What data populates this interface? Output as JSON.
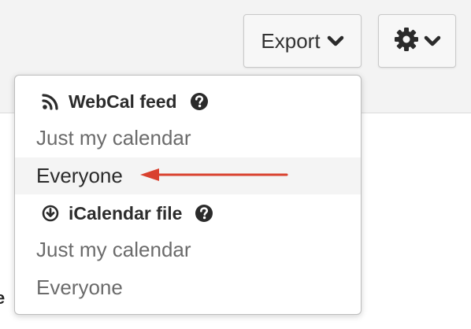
{
  "toolbar": {
    "export_label": "Export",
    "export_icon": "chevron-down-icon",
    "settings_icon": "gear-icon"
  },
  "background": {
    "edge_text": "e"
  },
  "dropdown": {
    "sections": [
      {
        "title": "WebCal feed",
        "icon": "rss-icon",
        "help_icon": "question-circle-icon",
        "items": [
          "Just my calendar",
          "Everyone"
        ]
      },
      {
        "title": "iCalendar file",
        "icon": "download-circle-icon",
        "help_icon": "question-circle-icon",
        "items": [
          "Just my calendar",
          "Everyone"
        ]
      }
    ],
    "highlighted_item": "Everyone (WebCal feed)"
  },
  "annotation": {
    "arrow_color": "#d9412e"
  }
}
